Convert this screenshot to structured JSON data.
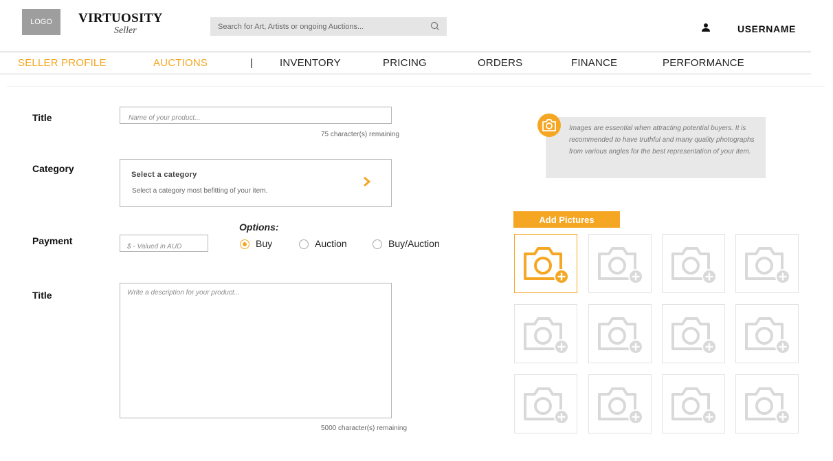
{
  "header": {
    "logo": "LOGO",
    "brand": "VIRTUOSITY",
    "brand_sub": "Seller",
    "search_placeholder": "Search for Art, Artists or ongoing Auctions...",
    "username": "USERNAME"
  },
  "nav": {
    "items": [
      "SELLER PROFILE",
      "AUCTIONS",
      "|",
      "INVENTORY",
      "PRICING",
      "ORDERS",
      "FINANCE",
      "PERFORMANCE"
    ]
  },
  "form": {
    "title_label": "Title",
    "title_placeholder": "Name of your product...",
    "title_remaining": "75 character(s) remaining",
    "category_label": "Category",
    "category_title": "Select a category",
    "category_sub": "Select a category most befitting of your item.",
    "payment_label": "Payment",
    "payment_placeholder": "$ - Valued in AUD",
    "options_label": "Options:",
    "options": [
      "Buy",
      "Auction",
      "Buy/Auction"
    ],
    "selected_option": "Buy",
    "description_label": "Title",
    "description_placeholder": "Write a description for your product...",
    "description_remaining": "5000 character(s) remaining"
  },
  "pictures": {
    "info_text": "Images are essential when attracting potential buyers. It is recommended to have truthful and many quality photographs from various angles for the best representation of your item.",
    "add_button": "Add Pictures",
    "slot_count": 12,
    "active_slot": 0
  },
  "colors": {
    "accent": "#f5a623",
    "placeholder_icon": "#d9d9d9",
    "info_bg": "#e8e8e8"
  }
}
